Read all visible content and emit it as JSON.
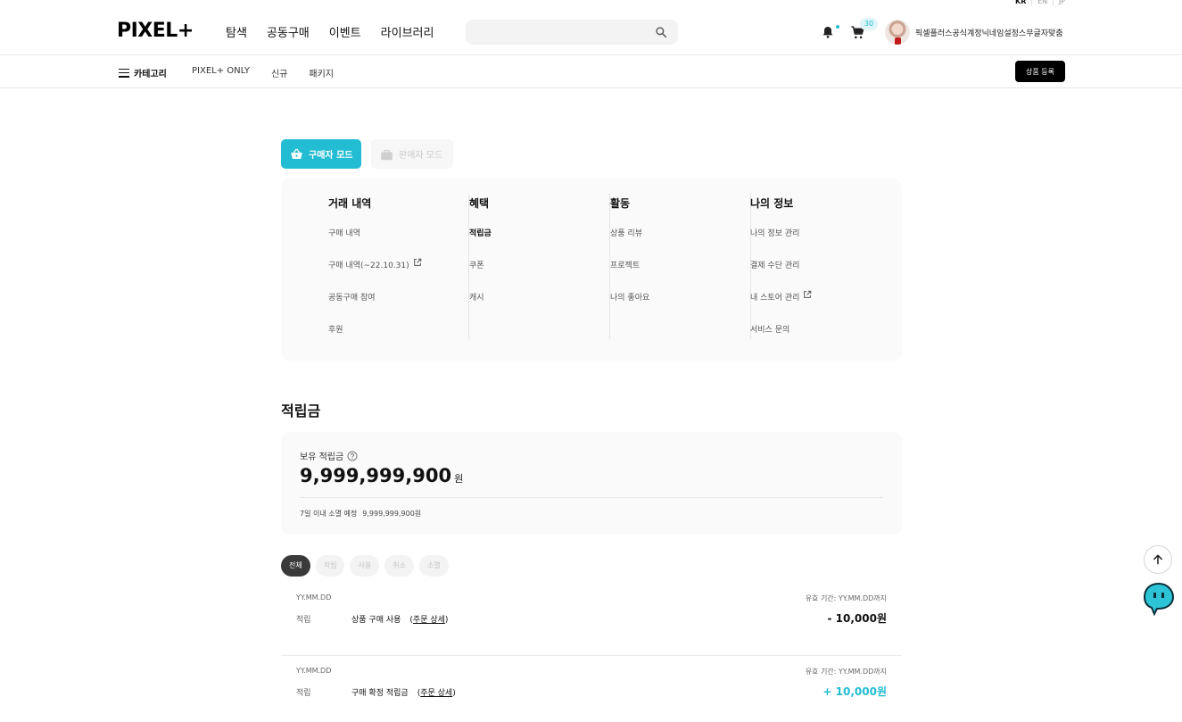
{
  "lang": {
    "kr": "KR",
    "en": "EN",
    "jp": "JP"
  },
  "header": {
    "logo": "PIXEL+",
    "nav": [
      "탐색",
      "공동구매",
      "이벤트",
      "라이브러리"
    ],
    "search_placeholder": "",
    "cart_count": "30",
    "nickname": "픽셀플러스공식계정닉네임설정스무글자맞춤"
  },
  "subnav": {
    "category": "카테고리",
    "links": [
      "PIXEL+ ONLY",
      "신규",
      "패키지"
    ],
    "register_button": "상품 등록"
  },
  "modes": {
    "buyer": "구매자 모드",
    "seller": "판매자 모드",
    "active": "buyer"
  },
  "menu": [
    {
      "title": "거래 내역",
      "items": [
        "구매 내역",
        "구매 내역(~22.10.31)",
        "공동구매 참여",
        "후원"
      ]
    },
    {
      "title": "혜택",
      "items": [
        "적립금",
        "쿠폰",
        "캐시"
      ]
    },
    {
      "title": "활동",
      "items": [
        "상품 리뷰",
        "프로젝트",
        "나의 좋아요"
      ]
    },
    {
      "title": "나의 정보",
      "items": [
        "나의 정보 관리",
        "결제 수단 관리",
        "내 스토어 관리",
        "서비스 문의"
      ]
    }
  ],
  "points": {
    "section_title": "적립금",
    "balance_label": "보유 적립금",
    "balance": "9,999,999,900",
    "unit": "원",
    "expiring_label": "7일 이내 소멸 예정",
    "expiring_amount": "9,999,999,900원"
  },
  "filters": [
    "전체",
    "적립",
    "사용",
    "취소",
    "소멸"
  ],
  "history": [
    {
      "date": "YY.MM.DD",
      "type": "적립",
      "desc": "상품 구매 사용",
      "detail": "주문 상세",
      "valid": "유효 기간: YY.MM.DD까지",
      "amount": "- 10,000원",
      "sign": "minus"
    },
    {
      "date": "YY.MM.DD",
      "type": "적립",
      "desc": "구매 확정 적립금",
      "detail": "주문 상세",
      "valid": "유효 기간: YY.MM.DD까지",
      "amount": "+ 10,000원",
      "sign": "plus"
    }
  ],
  "colors": {
    "accent": "#23bdd3",
    "dark": "#000000",
    "panel": "#fafafa"
  },
  "icons": [
    "search-icon",
    "bell-icon",
    "cart-icon",
    "hamburger-icon",
    "basket-icon",
    "bag-icon",
    "external-link-icon",
    "help-icon",
    "arrow-up-icon",
    "chat-mascot-icon"
  ]
}
